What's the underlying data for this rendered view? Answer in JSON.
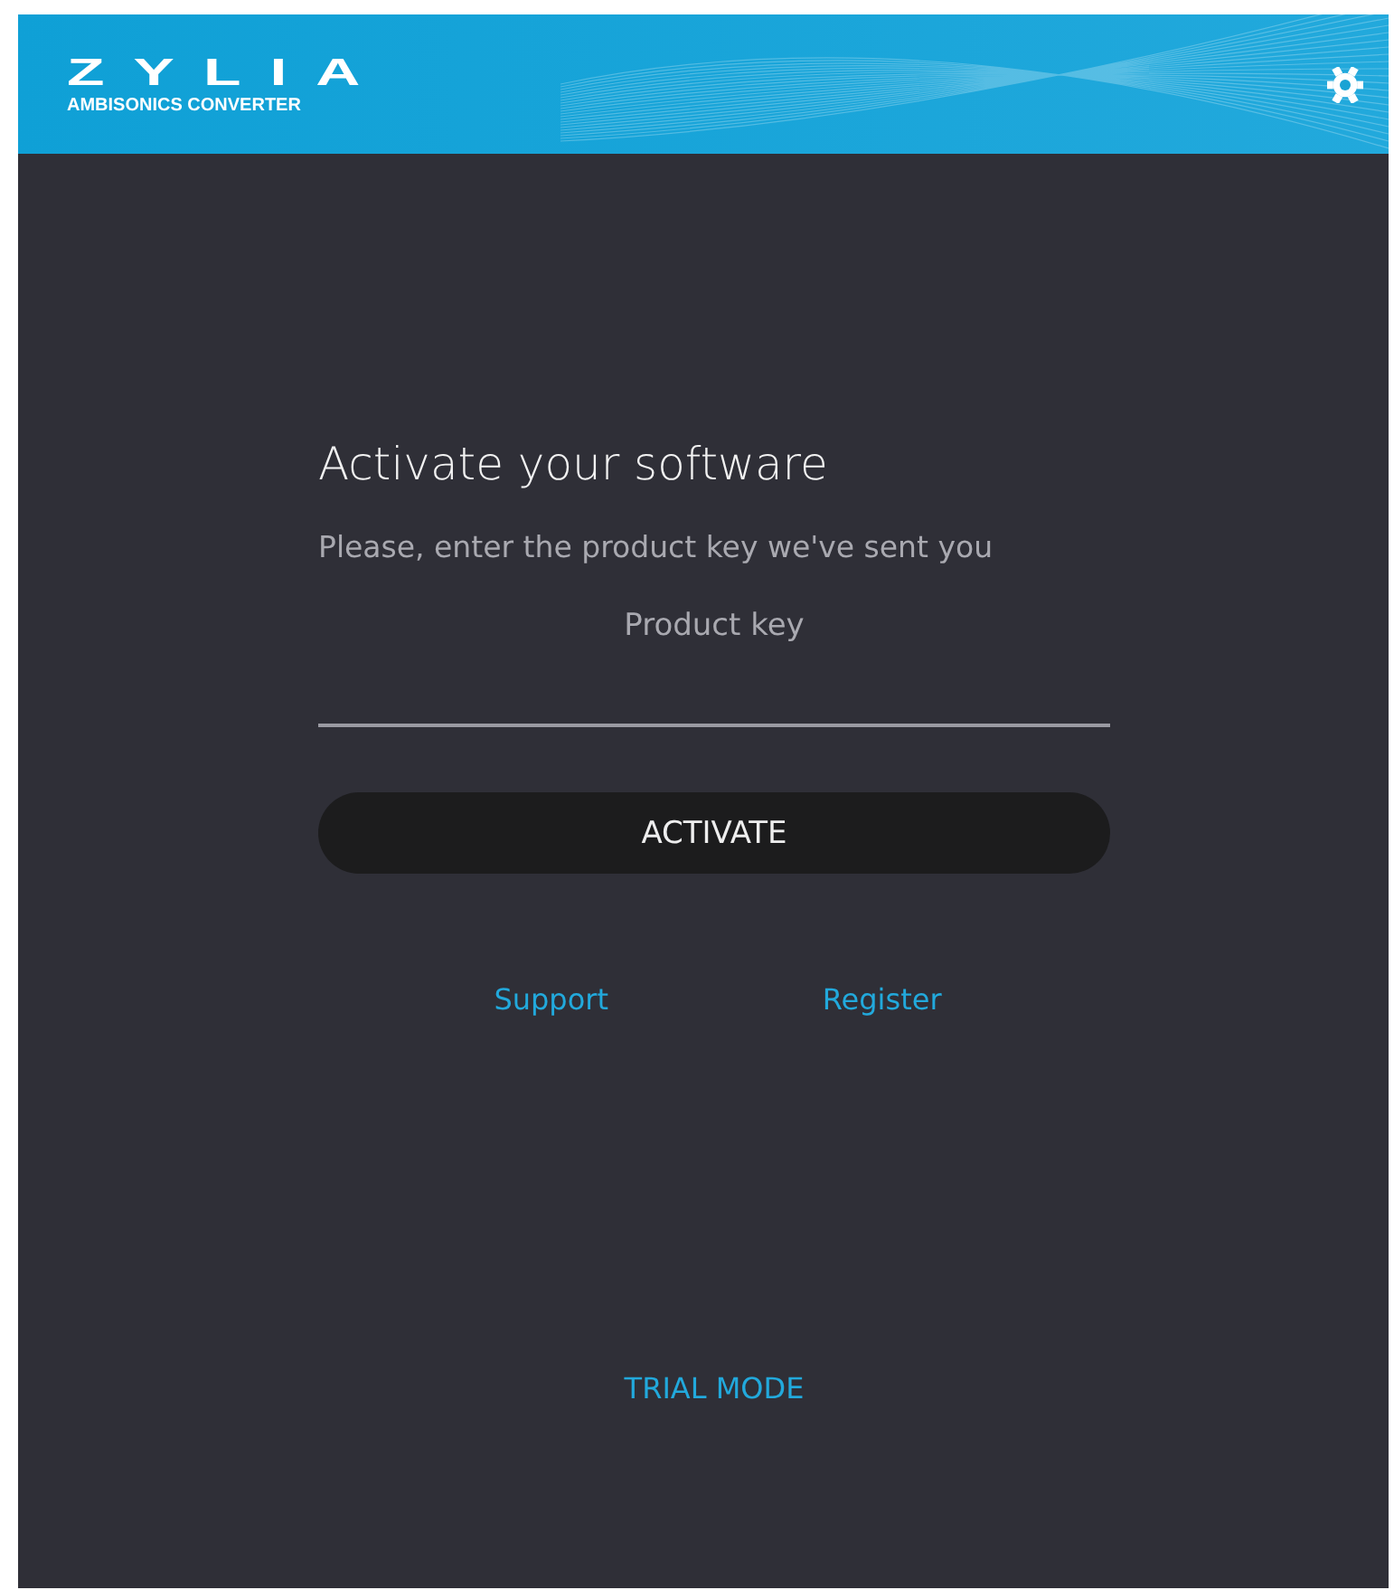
{
  "header": {
    "logo": "ZYLIA",
    "subtitle": "AMBISONICS CONVERTER"
  },
  "activation": {
    "title": "Activate your software",
    "instruction": "Please, enter the product key we've sent you",
    "product_key": {
      "placeholder": "Product key"
    },
    "button": "ACTIVATE",
    "links": [
      "Support",
      "Register"
    ]
  },
  "footer_link": "TRIAL MODE"
}
